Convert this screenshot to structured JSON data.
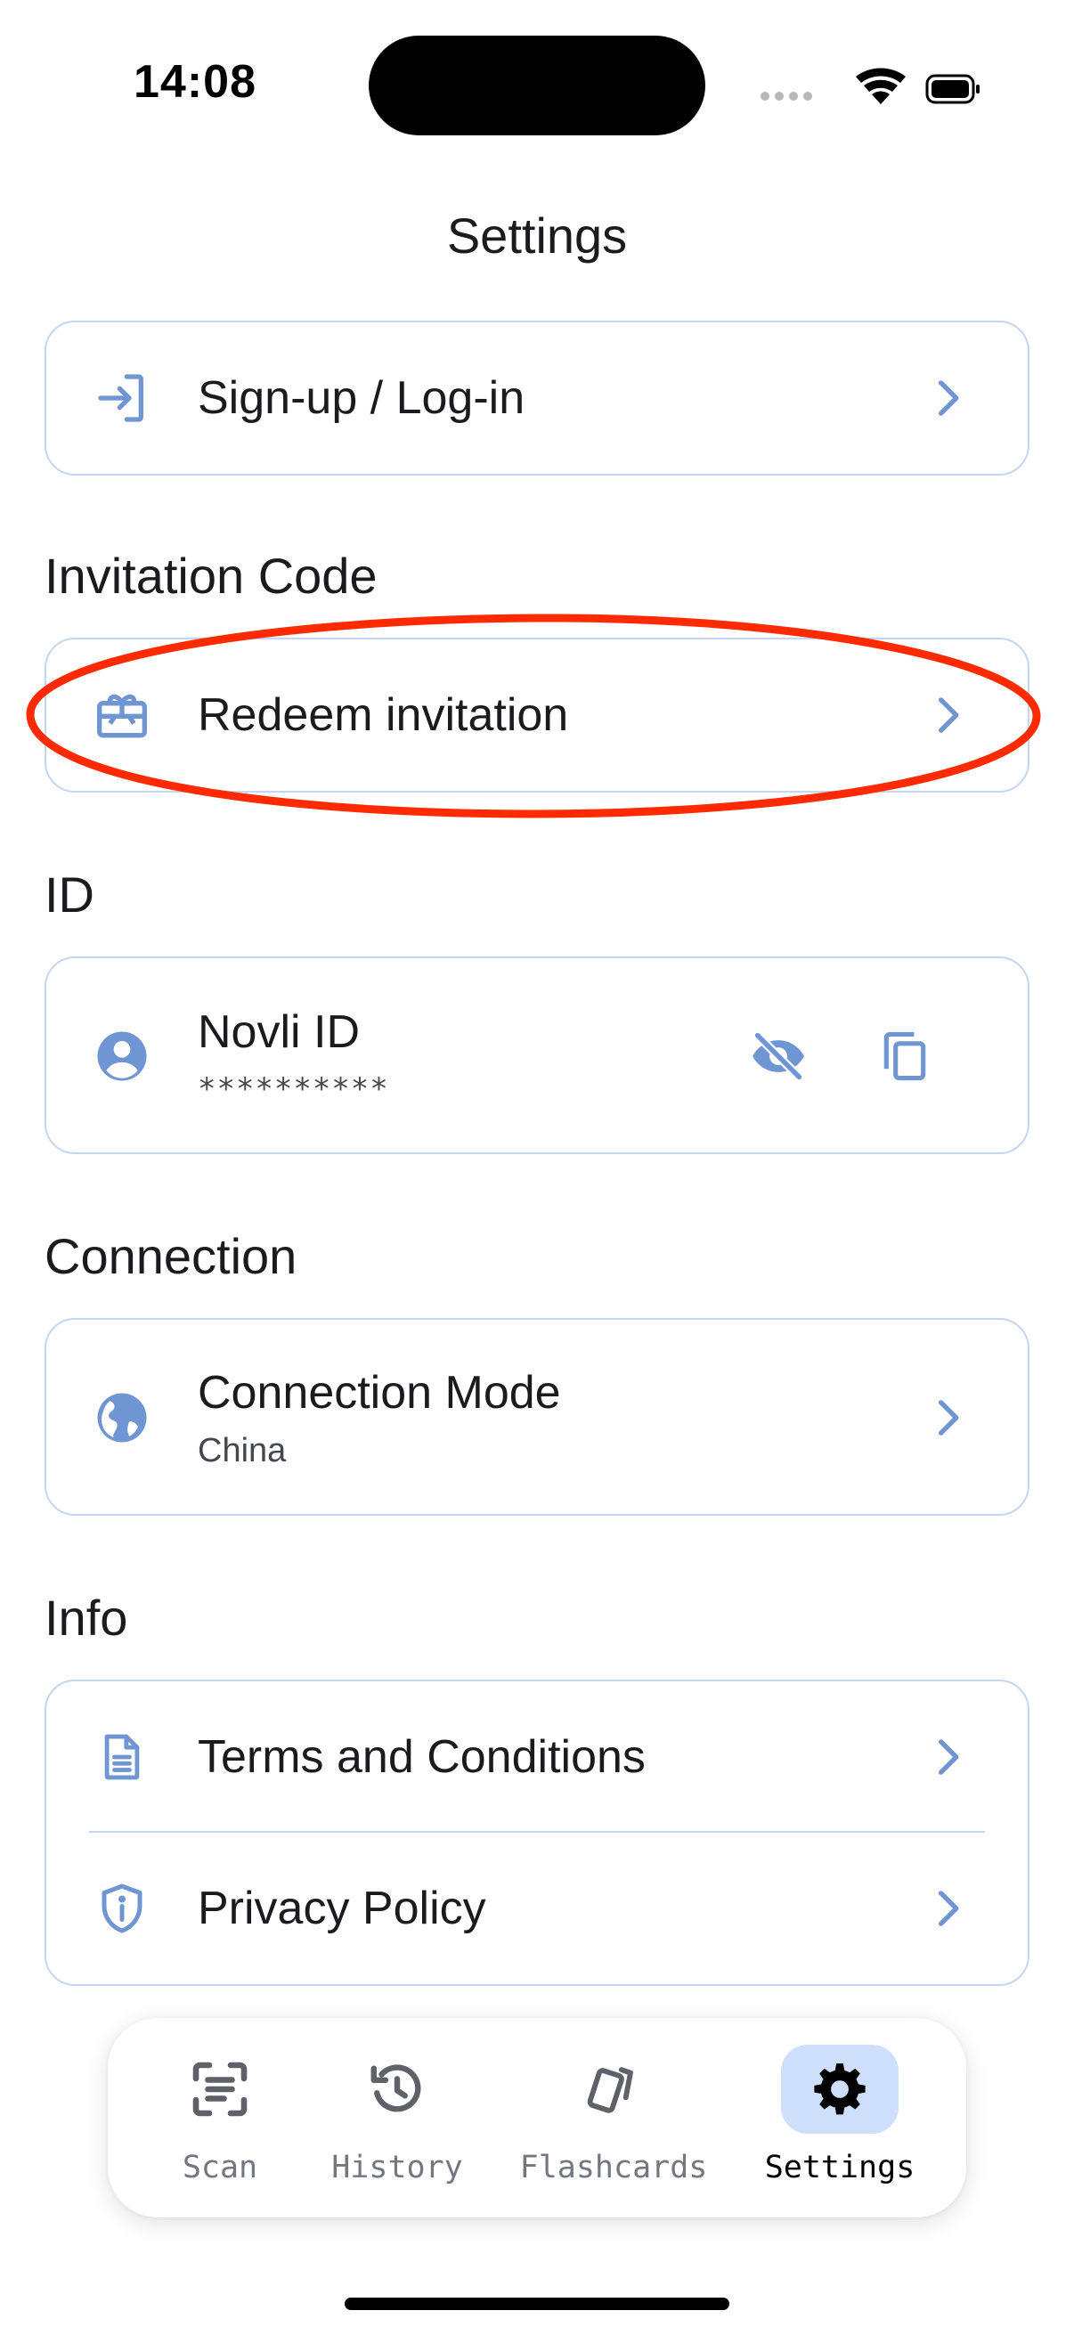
{
  "status_bar": {
    "time": "14:08"
  },
  "header": {
    "title": "Settings"
  },
  "account": {
    "label": "Sign-up / Log-in",
    "icon": "login-icon"
  },
  "invitation": {
    "section_title": "Invitation Code",
    "label": "Redeem invitation",
    "icon": "redeem-icon"
  },
  "id_section": {
    "section_title": "ID",
    "label": "Novli ID",
    "value": "**********",
    "icon": "account-circle-icon",
    "actions": [
      "visibility-off-icon",
      "copy-icon"
    ]
  },
  "connection": {
    "section_title": "Connection",
    "label": "Connection Mode",
    "value": "China",
    "icon": "globe-icon"
  },
  "info": {
    "section_title": "Info",
    "items": [
      {
        "label": "Terms and Conditions",
        "icon": "document-icon"
      },
      {
        "label": "Privacy Policy",
        "icon": "shield-icon"
      }
    ]
  },
  "nav": {
    "items": [
      {
        "label": "Scan",
        "icon": "scan-icon",
        "active": false
      },
      {
        "label": "History",
        "icon": "history-icon",
        "active": false
      },
      {
        "label": "Flashcards",
        "icon": "flashcards-icon",
        "active": false
      },
      {
        "label": "Settings",
        "icon": "gear-icon",
        "active": true
      }
    ]
  },
  "colors": {
    "accent": "#6f95d2",
    "card_border": "#c4d6f2",
    "nav_active_bg": "#cddffb",
    "annotation": "#ff2a00"
  }
}
